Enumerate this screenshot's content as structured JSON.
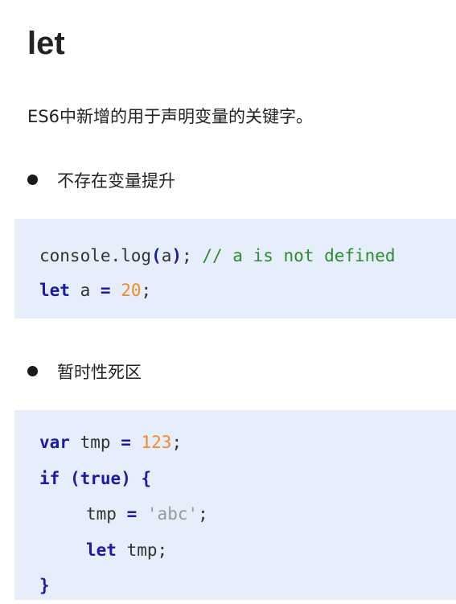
{
  "title": "let",
  "intro": "ES6中新增的用于声明变量的关键字。",
  "sections": [
    {
      "bullet": "不存在变量提升",
      "code": {
        "line1": {
          "call": "console.log",
          "open": "(",
          "arg": "a",
          "close": ")",
          "semi": ";",
          "comment": "// a is not defined"
        },
        "line2": {
          "kw": "let",
          "name": "a",
          "eq": "=",
          "value": "20",
          "semi": ";"
        }
      }
    },
    {
      "bullet": "暂时性死区",
      "code": {
        "line1": {
          "kw": "var",
          "name": "tmp",
          "eq": "=",
          "value": "123",
          "semi": ";"
        },
        "line2": {
          "kw": "if",
          "open": "(",
          "cond": "true",
          "close": ")",
          "brace": "{"
        },
        "line3": {
          "name": "tmp",
          "eq": "=",
          "value": "'abc'",
          "semi": ";"
        },
        "line4": {
          "kw": "let",
          "name": "tmp",
          "semi": ";"
        },
        "line5": {
          "brace": "}"
        }
      }
    }
  ]
}
